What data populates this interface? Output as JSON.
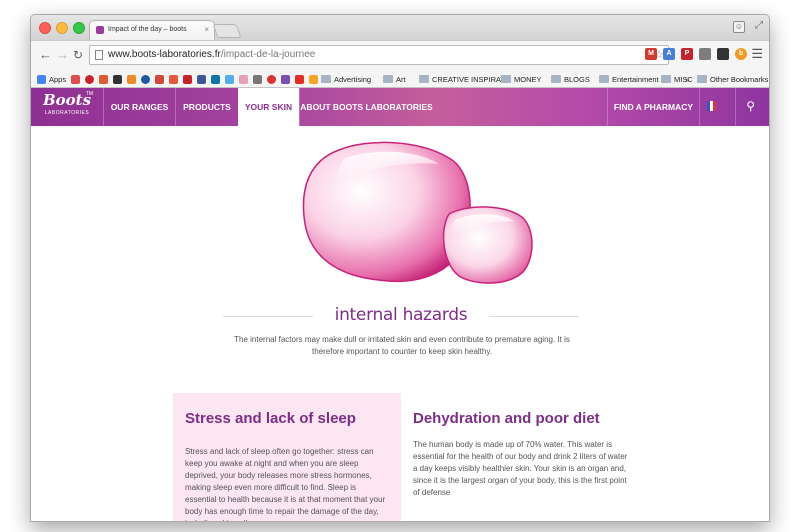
{
  "browser": {
    "tab_title": "Impact of the day – boots",
    "tab_close": "×",
    "url_host": "www.boots-laboratories.fr",
    "url_path": "/impact-de-la-journee",
    "bookmarks": {
      "apps": "Apps",
      "items": [
        "Advertising",
        "Art",
        "CREATIVE INSPIRATI",
        "MONEY",
        "BLOGS",
        "Entertainment",
        "MISC"
      ],
      "overflow": "»",
      "other": "Other Bookmarks"
    }
  },
  "site": {
    "logo_text": "Boots",
    "logo_sub": "LABORATORIES",
    "logo_tm": "TM",
    "nav": [
      "OUR RANGES",
      "PRODUCTS",
      "YOUR SKIN",
      "ABOUT BOOTS LABORATORIES"
    ],
    "find_pharmacy": "FIND A PHARMACY",
    "brand_color": "#8e2f93"
  },
  "main": {
    "section_title": "internal hazards",
    "intro": "The internal factors may make dull or irritated skin and even contribute to premature aging. It is therefore important to counter to keep skin healthy.",
    "cards": [
      {
        "title": "Stress and lack of sleep",
        "body": "Stress and lack of sleep often go together: stress can keep you awake at night and when you are sleep deprived, your body releases more stress hormones, making sleep even more difficult to find. Sleep is essential to health because it is at that moment that your body has enough time to repair the damage of the day, including skin cells."
      },
      {
        "title": "Dehydration and poor diet",
        "body": "The human body is made up of 70% water. This water is essential for the health of our body and drink 2 liters of water a day keeps visibly healthier skin. Your skin is an organ and, since it is the largest organ of your body, this is the first point of defense"
      }
    ]
  }
}
